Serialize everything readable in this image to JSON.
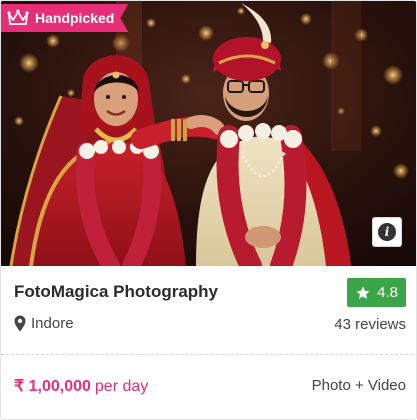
{
  "badge": {
    "label": "Handpicked",
    "icon": "crown-icon"
  },
  "photo": {
    "alt": "Bride and groom couple portrait",
    "info_icon": "i"
  },
  "vendor": {
    "name": "FotoMagica Photography",
    "rating": "4.8",
    "location": "Indore",
    "reviews": "43 reviews",
    "price": "₹ 1,00,000",
    "price_unit": "per day",
    "services": "Photo + Video"
  },
  "colors": {
    "accent": "#e72e77",
    "rating_green": "#3aa647"
  }
}
